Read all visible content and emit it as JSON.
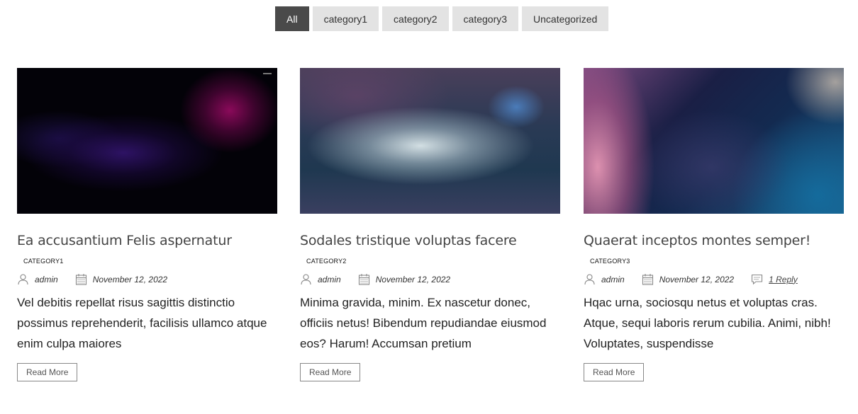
{
  "filters": [
    {
      "label": "All",
      "active": true
    },
    {
      "label": "category1",
      "active": false
    },
    {
      "label": "category2",
      "active": false
    },
    {
      "label": "category3",
      "active": false
    },
    {
      "label": "Uncategorized",
      "active": false
    }
  ],
  "posts": [
    {
      "title": "Ea accusantium Felis aspernatur",
      "category": "CATEGORY1",
      "author": "admin",
      "date": "November 12, 2022",
      "excerpt": "Vel debitis repellat risus sagittis distinctio possimus reprehenderit, facilisis ullamco atque enim culpa maiores",
      "read_more": "Read More"
    },
    {
      "title": "Sodales tristique voluptas facere",
      "category": "CATEGORY2",
      "author": "admin",
      "date": "November 12, 2022",
      "excerpt": "Minima gravida, minim. Ex nascetur donec, officiis netus! Bibendum repudiandae eiusmod eos? Harum! Accumsan pretium",
      "read_more": "Read More"
    },
    {
      "title": "Quaerat inceptos montes semper!",
      "category": "CATEGORY3",
      "author": "admin",
      "date": "November 12, 2022",
      "comments": "1 Reply",
      "excerpt": "Hqac urna, sociosqu netus et voluptas cras. Atque, sequi laboris rerum cubilia. Animi, nibh! Voluptates, suspendisse",
      "read_more": "Read More"
    }
  ]
}
